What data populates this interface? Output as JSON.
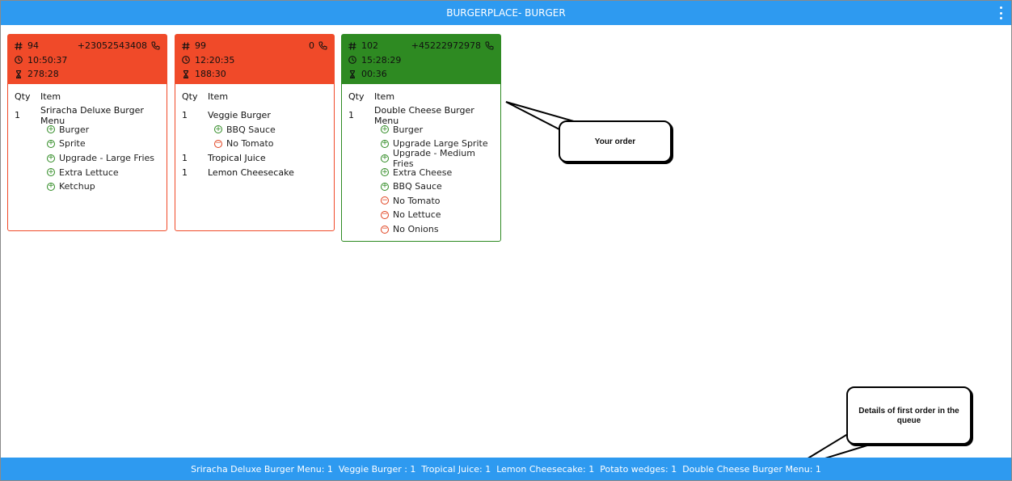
{
  "header": {
    "title": "BURGERPLACE- BURGER"
  },
  "cards": [
    {
      "order": "94",
      "phone": "+23052543408",
      "time": "10:50:37",
      "elapsed": "278:28",
      "qty_header": "Qty",
      "item_header": "Item",
      "lines": [
        {
          "qty": "1",
          "item": "Sriracha Deluxe Burger Menu",
          "mods": [
            {
              "type": "add",
              "label": "Burger"
            },
            {
              "type": "add",
              "label": "Sprite"
            },
            {
              "type": "add",
              "label": "Upgrade - Large Fries"
            },
            {
              "type": "add",
              "label": "Extra Lettuce"
            },
            {
              "type": "add",
              "label": "Ketchup"
            }
          ]
        }
      ]
    },
    {
      "order": "99",
      "phone": "0",
      "time": "12:20:35",
      "elapsed": "188:30",
      "qty_header": "Qty",
      "item_header": "Item",
      "lines": [
        {
          "qty": "1",
          "item": "Veggie Burger",
          "mods": [
            {
              "type": "add",
              "label": "BBQ Sauce"
            },
            {
              "type": "remove",
              "label": "No Tomato"
            }
          ]
        },
        {
          "qty": "1",
          "item": "Tropical Juice",
          "mods": []
        },
        {
          "qty": "1",
          "item": "Lemon Cheesecake",
          "mods": []
        }
      ]
    },
    {
      "order": "102",
      "phone": "+45222972978",
      "time": "15:28:29",
      "elapsed": "00:36",
      "qty_header": "Qty",
      "item_header": "Item",
      "lines": [
        {
          "qty": "1",
          "item": "Double Cheese Burger Menu",
          "mods": [
            {
              "type": "add",
              "label": "Burger"
            },
            {
              "type": "add",
              "label": "Upgrade Large Sprite"
            },
            {
              "type": "add",
              "label": "Upgrade - Medium Fries"
            },
            {
              "type": "add",
              "label": "Extra Cheese"
            },
            {
              "type": "add",
              "label": "BBQ Sauce"
            },
            {
              "type": "remove",
              "label": "No Tomato"
            },
            {
              "type": "remove",
              "label": "No Lettuce"
            },
            {
              "type": "remove",
              "label": "No Onions"
            }
          ]
        }
      ]
    }
  ],
  "footer": {
    "summary": "Sriracha Deluxe Burger Menu: 1  Veggie Burger : 1  Tropical Juice: 1  Lemon Cheesecake: 1  Potato wedges: 1  Double Cheese Burger Menu: 1"
  },
  "callouts": {
    "your_order": "Your order",
    "first_order": "Details of first order in the queue"
  },
  "colors": {
    "header": "#2e9af0",
    "pending": "#f04a29",
    "current": "#2e8a22",
    "add": "#2e8a22",
    "remove": "#e0421f"
  }
}
